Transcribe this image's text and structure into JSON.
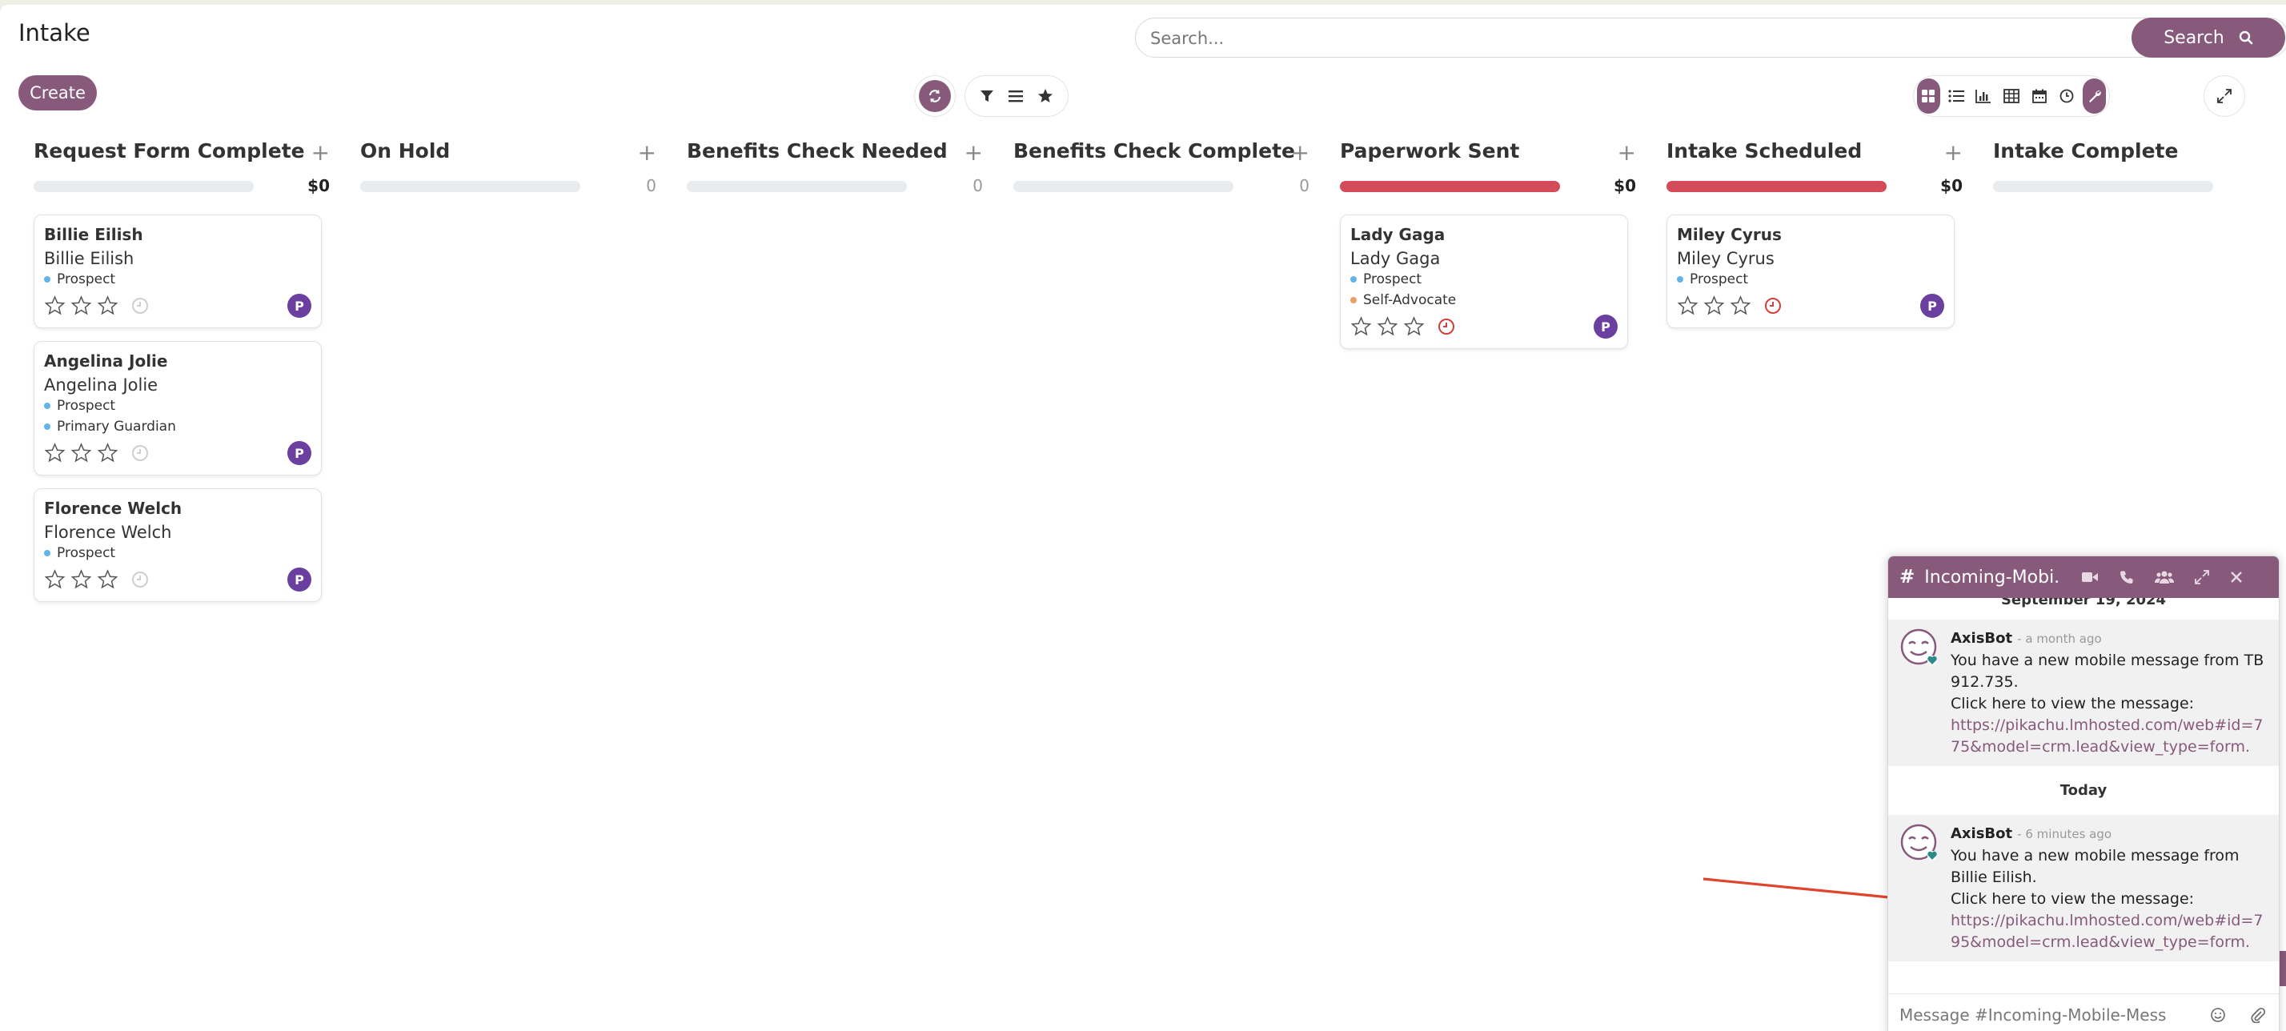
{
  "header": {
    "title": "Intake",
    "search_placeholder": "Search...",
    "search_label": "Search",
    "create_label": "Create"
  },
  "icons": {
    "reload": "reload-icon",
    "filter": "filter-icon",
    "group": "group-by-icon",
    "favorite": "star-icon",
    "views": [
      "kanban-icon",
      "list-icon",
      "graph-icon",
      "pivot-icon",
      "calendar-icon",
      "activity-icon",
      "wrench-icon"
    ],
    "expand": "expand-icon"
  },
  "colors": {
    "brand": "#875a7b",
    "progress_red": "#d44c59",
    "tag_blue": "#63b3e8",
    "tag_orange": "#e8a063",
    "avatar": "#6b3fa0"
  },
  "columns": [
    {
      "title": "Request Form Complete",
      "total": "$0",
      "progress": 0,
      "cards": [
        {
          "title": "Billie Eilish",
          "sub": "Billie Eilish",
          "tags": [
            {
              "label": "Prospect",
              "color": "blue"
            }
          ],
          "activity": "none",
          "avatar": "P"
        },
        {
          "title": "Angelina Jolie",
          "sub": "Angelina Jolie",
          "tags": [
            {
              "label": "Prospect",
              "color": "blue"
            },
            {
              "label": "Primary Guardian",
              "color": "blue"
            }
          ],
          "activity": "none",
          "avatar": "P"
        },
        {
          "title": "Florence Welch",
          "sub": "Florence Welch",
          "tags": [
            {
              "label": "Prospect",
              "color": "blue"
            }
          ],
          "activity": "none",
          "avatar": "P"
        }
      ]
    },
    {
      "title": "On Hold",
      "total": "0",
      "progress": 0,
      "cards": []
    },
    {
      "title": "Benefits Check Needed",
      "total": "0",
      "progress": 0,
      "cards": []
    },
    {
      "title": "Benefits Check Complete",
      "total": "0",
      "progress": 0,
      "cards": []
    },
    {
      "title": "Paperwork Sent",
      "total": "$0",
      "progress": 1,
      "cards": [
        {
          "title": "Lady Gaga",
          "sub": "Lady Gaga",
          "tags": [
            {
              "label": "Prospect",
              "color": "blue"
            },
            {
              "label": "Self-Advocate",
              "color": "orange"
            }
          ],
          "activity": "overdue",
          "avatar": "P"
        }
      ]
    },
    {
      "title": "Intake Scheduled",
      "total": "$0",
      "progress": 1,
      "cards": [
        {
          "title": "Miley Cyrus",
          "sub": "Miley Cyrus",
          "tags": [
            {
              "label": "Prospect",
              "color": "blue"
            }
          ],
          "activity": "overdue",
          "avatar": "P"
        }
      ]
    },
    {
      "title": "Intake Complete",
      "total": "",
      "progress": 0,
      "cards": []
    }
  ],
  "chat": {
    "hash": "#",
    "title": "Incoming-Mobi...",
    "date1": "September 19, 2024",
    "date2": "Today",
    "messages": [
      {
        "author": "AxisBot",
        "time": "- a month ago",
        "line1": "You have a new mobile message from TB 912.735.",
        "line2": "Click here to view the message:",
        "link": "https://pikachu.lmhosted.com/web#id=775&model=crm.lead&view_type=form."
      },
      {
        "author": "AxisBot",
        "time": "- 6 minutes ago",
        "line1": "You have a new mobile message from Billie Eilish.",
        "line2": "Click here to view the message:",
        "link": "https://pikachu.lmhosted.com/web#id=795&model=crm.lead&view_type=form."
      }
    ],
    "composer_placeholder": "Message #Incoming-Mobile-Mess"
  }
}
